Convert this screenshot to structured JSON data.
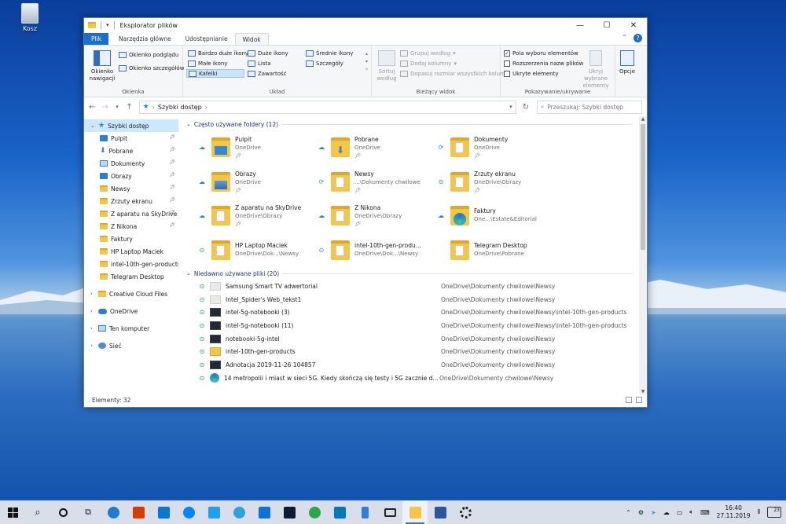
{
  "desktop": {
    "recycle_label": "Kosz"
  },
  "window": {
    "title": "Eksplorator plików",
    "controls": {
      "minimize": "—",
      "maximize": "☐",
      "close": "✕"
    }
  },
  "ribbon_tabs": [
    {
      "label": "Plik"
    },
    {
      "label": "Narzędzia główne"
    },
    {
      "label": "Udostępnianie"
    },
    {
      "label": "Widok"
    }
  ],
  "ribbon": {
    "panes": {
      "navigation_pane": "Okienko nawigacji",
      "preview_pane": "Okienko podglądu",
      "details_pane": "Okienko szczegółów",
      "group_label": "Okienka"
    },
    "layout": {
      "items": [
        "Bardzo duże ikony",
        "Duże ikony",
        "Średnie ikony",
        "Małe ikony",
        "Lista",
        "Szczegóły",
        "Kafelki",
        "Zawartość"
      ],
      "group_label": "Układ"
    },
    "current_view": {
      "sort_by": "Sortuj według",
      "group_by": "Grupuj według",
      "add_columns": "Dodaj kolumny",
      "fit_columns": "Dopasuj rozmiar wszystkich kolumn",
      "group_label": "Bieżący widok"
    },
    "show_hide": {
      "item_checkboxes": "Pola wyboru elementów",
      "file_extensions": "Rozszerzenia nazw plików",
      "hidden_items": "Ukryte elementy",
      "hide_selected": "Ukryj wybrane elementy",
      "group_label": "Pokazywanie/ukrywanie"
    },
    "options": "Opcje"
  },
  "address": {
    "path": "Szybki dostęp",
    "search_placeholder": "Przeszukaj: Szybki dostęp"
  },
  "nav_pane": {
    "quick_access": "Szybki dostęp",
    "pinned": [
      {
        "label": "Pulpit",
        "icon": "blue"
      },
      {
        "label": "Pobrane",
        "icon": "download"
      },
      {
        "label": "Dokumenty",
        "icon": "doc"
      },
      {
        "label": "Obrazy",
        "icon": "pictures"
      },
      {
        "label": "Newsy",
        "icon": "folder"
      },
      {
        "label": "Zrzuty ekranu",
        "icon": "folder"
      },
      {
        "label": "Z aparatu na SkyDrive",
        "icon": "folder"
      },
      {
        "label": "Z Nikona",
        "icon": "folder"
      }
    ],
    "recent": [
      "Faktury",
      "HP Laptop Maciek",
      "intel-10th-gen-products",
      "Telegram Desktop"
    ],
    "roots": [
      "Creative Cloud Files",
      "OneDrive",
      "Ten komputer",
      "Sieć"
    ]
  },
  "frequent": {
    "header": "Często używane foldery (12)",
    "items": [
      {
        "name": "Pulpit",
        "loc": "OneDrive",
        "status": "cloud",
        "pinned": true,
        "icon": "blue"
      },
      {
        "name": "Pobrane",
        "loc": "OneDrive",
        "status": "cloud",
        "pinned": true,
        "icon": "download"
      },
      {
        "name": "Dokumenty",
        "loc": "OneDrive",
        "status": "sync",
        "pinned": true,
        "icon": "doc"
      },
      {
        "name": "Obrazy",
        "loc": "OneDrive",
        "status": "cloud",
        "pinned": true,
        "icon": "pictures"
      },
      {
        "name": "Newsy",
        "loc": "...\\Dokumenty chwilowe",
        "status": "sync",
        "pinned": true,
        "icon": "doc"
      },
      {
        "name": "Zrzuty ekranu",
        "loc": "OneDrive\\Obrazy",
        "status": "ok",
        "pinned": true,
        "icon": "doc"
      },
      {
        "name": "Z aparatu na SkyDrive",
        "loc": "OneDrive\\Obrazy",
        "status": "cloud",
        "pinned": true,
        "icon": "doc"
      },
      {
        "name": "Z Nikona",
        "loc": "OneDrive\\Obrazy",
        "status": "cloud",
        "pinned": true,
        "icon": "doc"
      },
      {
        "name": "Faktury",
        "loc": "One...\\Estate&Editorial",
        "status": "cloud",
        "pinned": false,
        "icon": "edge"
      },
      {
        "name": "HP Laptop Maciek",
        "loc": "OneDrive\\Dok...\\Newsy",
        "status": "ok",
        "pinned": false,
        "icon": "doc"
      },
      {
        "name": "intel-10th-gen-produ...",
        "loc": "OneDrive\\Dok...\\Newsy",
        "status": "ok",
        "pinned": false,
        "icon": "doc"
      },
      {
        "name": "Telegram Desktop",
        "loc": "OneDrive\\Pobrane",
        "status": "none",
        "pinned": false,
        "icon": "doc"
      }
    ]
  },
  "recent_files": {
    "header": "Niedawno używane pliki (20)",
    "items": [
      {
        "name": "Samsung Smart TV adwertorial",
        "loc": "OneDrive\\Dokumenty chwilowe\\Newsy",
        "status": "ok",
        "thumb": "doc"
      },
      {
        "name": "Intel_Spider's Web_tekst1",
        "loc": "OneDrive\\Dokumenty chwilowe\\Newsy",
        "status": "ok",
        "thumb": "doc"
      },
      {
        "name": "intel-5g-notebooki (3)",
        "loc": "OneDrive\\Dokumenty chwilowe\\Newsy\\intel-10th-gen-products",
        "status": "ok",
        "thumb": "dark"
      },
      {
        "name": "intel-5g-notebooki (11)",
        "loc": "OneDrive\\Dokumenty chwilowe\\Newsy\\intel-10th-gen-products",
        "status": "ok",
        "thumb": "dark"
      },
      {
        "name": "notebooki-5g-intel",
        "loc": "OneDrive\\Dokumenty chwilowe\\Newsy",
        "status": "ok",
        "thumb": "dark"
      },
      {
        "name": "intel-10th-gen-products",
        "loc": "OneDrive\\Dokumenty chwilowe\\Newsy",
        "status": "ok",
        "thumb": "folder"
      },
      {
        "name": "Adnotacja 2019-11-26 104857",
        "loc": "OneDrive\\Dokumenty chwilowe\\Newsy",
        "status": "ok",
        "thumb": "dark"
      },
      {
        "name": "14 metropolii i miast w sieci 5G. Kiedy skończą się testy i 5G zacznie dz...",
        "loc": "OneDrive\\Dokumenty chwilowe\\Newsy",
        "status": "ok",
        "thumb": "edge"
      }
    ]
  },
  "status_bar": {
    "count": "Elementy: 32"
  },
  "taskbar": {
    "apps": [
      {
        "name": "edge-icon",
        "color": "#1b7fd1"
      },
      {
        "name": "office-icon",
        "color": "#d83b01"
      },
      {
        "name": "store-icon",
        "color": "#0078d7"
      },
      {
        "name": "messenger-icon",
        "color": "#0084ff"
      },
      {
        "name": "twitter-icon",
        "color": "#1da1f2"
      },
      {
        "name": "telegram-icon",
        "color": "#2aa3df"
      },
      {
        "name": "windows-logo-app-icon",
        "color": "#0a75d4"
      },
      {
        "name": "photoshop-icon",
        "color": "#0a1d33"
      },
      {
        "name": "chrome-icon",
        "color": "#2aa84a"
      },
      {
        "name": "trello-icon",
        "color": "#0079bf"
      },
      {
        "name": "phone-icon",
        "color": "#2f7fd6"
      },
      {
        "name": "mail-icon",
        "color": "#222222"
      },
      {
        "name": "file-explorer-icon",
        "color": "#f5c544"
      },
      {
        "name": "word-icon",
        "color": "#2b579a"
      },
      {
        "name": "settings-icon",
        "color": "#222222"
      }
    ],
    "time": "16:40",
    "date": "27.11.2019",
    "notifications": "23"
  }
}
